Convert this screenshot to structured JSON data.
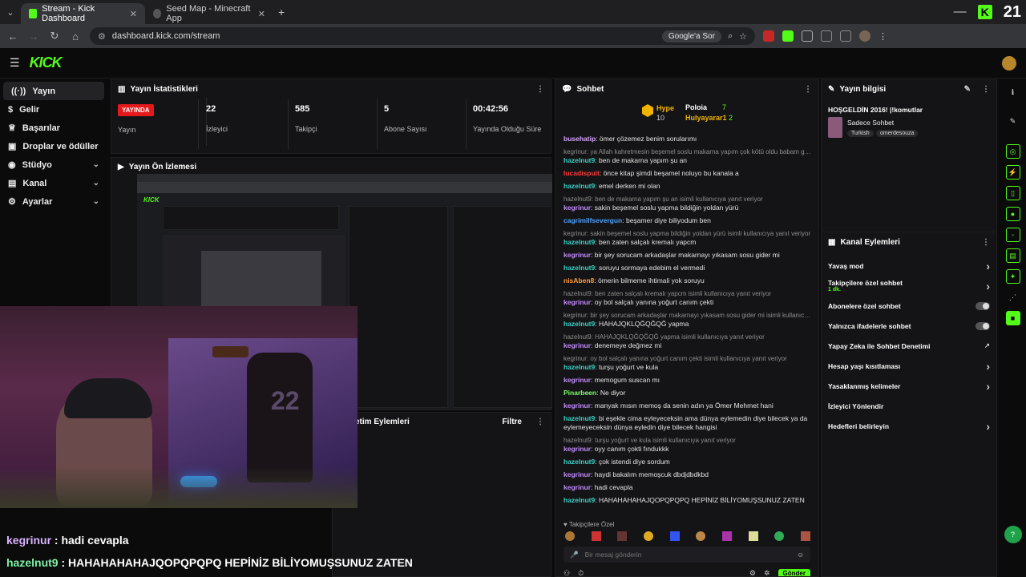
{
  "browser": {
    "tabs": [
      {
        "label": "Stream - Kick Dashboard",
        "active": true
      },
      {
        "label": "Seed Map - Minecraft App",
        "active": false
      }
    ],
    "url": "dashboard.kick.com/stream",
    "google_btn": "Google'a Sor",
    "badge_count": "21"
  },
  "sidebar": {
    "items": [
      {
        "label": "Yayın",
        "icon": "broadcast-icon",
        "active": true,
        "chevron": false
      },
      {
        "label": "Gelir",
        "icon": "dollar-icon",
        "active": false,
        "chevron": false
      },
      {
        "label": "Başarılar",
        "icon": "trophy-icon",
        "active": false,
        "chevron": false
      },
      {
        "label": "Droplar ve ödüller",
        "icon": "gift-icon",
        "active": false,
        "chevron": false
      },
      {
        "label": "Stüdyo",
        "icon": "studio-icon",
        "active": false,
        "chevron": true
      },
      {
        "label": "Kanal",
        "icon": "channel-icon",
        "active": false,
        "chevron": true
      },
      {
        "label": "Ayarlar",
        "icon": "gear-icon",
        "active": false,
        "chevron": true
      }
    ]
  },
  "stats": {
    "title": "Yayın İstatistikleri",
    "live_label": "YAYINDA",
    "live_caption": "Yayın",
    "viewers": {
      "value": "22",
      "label": "İzleyici"
    },
    "followers": {
      "value": "585",
      "label": "Takipçi"
    },
    "subs": {
      "value": "5",
      "label": "Abone Sayısı"
    },
    "duration": {
      "value": "00:42:56",
      "label": "Yayında Olduğu Süre"
    }
  },
  "preview": {
    "title": "Yayın Ön İzlemesi"
  },
  "actions": {
    "title": "etim Eylemleri",
    "filter": "Filtre"
  },
  "chat": {
    "title": "Sohbet",
    "hype_label": "Hype",
    "hype_value": "10",
    "leader1": "Poloia",
    "leader1_count": "7",
    "leader2": "Hulyayarar1",
    "leader2_count": "2",
    "messages": [
      {
        "reply": "",
        "user": "busehatip",
        "color": "#d7a6ff",
        "text": "ömer çözemez benim sorularımı"
      },
      {
        "reply": "kegrinur: ya Allah kahretmesin beşemel soslu makarna yapım çok kötü oldu babam göree agz...",
        "user": "hazelnut9",
        "color": "#3ad1c4",
        "text": "ben de makarna yapım şu an"
      },
      {
        "reply": "",
        "user": "lucadispuit",
        "color": "#ff3b3b",
        "text": "önce kitap şimdi beşamel noluyo bu kanala a"
      },
      {
        "reply": "",
        "user": "hazelnut9",
        "color": "#3ad1c4",
        "text": "emel derken mi olan"
      },
      {
        "reply": "hazelnut9: ben de makarna yapım şu an isimli kullanıcıya yanıt veriyor",
        "user": "kegrinur",
        "color": "#c38cff",
        "text": "sakin beşemel soslu yapma bildiğin yoldan yürü"
      },
      {
        "reply": "",
        "user": "cagrimilfsevergun",
        "color": "#4da3ff",
        "text": "beşamer diye biliyodum ben"
      },
      {
        "reply": "kegrinur: sakin beşemel soslu yapma bildiğin yoldan yürü isimli kullanıcıya yanıt veriyor",
        "user": "hazelnut9",
        "color": "#3ad1c4",
        "text": "ben zaten salçalı kremalı yapcm"
      },
      {
        "reply": "",
        "user": "kegrinur",
        "color": "#c38cff",
        "text": "bir şey sorucam arkadaşlar makarnayı yıkasam sosu gider mi"
      },
      {
        "reply": "",
        "user": "hazelnut9",
        "color": "#3ad1c4",
        "text": "soruyu sormaya edebim el vermedi"
      },
      {
        "reply": "",
        "user": "nisAben8",
        "color": "#ff9a3c",
        "text": "ömerin bilmeme ihtimali yok soruyu"
      },
      {
        "reply": "hazelnut9: ben zaten salçalı kremalı yapcm isimli kullanıcıya yanıt veriyor",
        "user": "kegrinur",
        "color": "#c38cff",
        "text": "oy bol salçalı yanına yoğurt canım çekti"
      },
      {
        "reply": "kegrinur: bir şey sorucam arkadaşlar makarnayı yıkasam sosu gider mi isimli kullanıcıya yanıt ve...",
        "user": "hazelnut9",
        "color": "#3ad1c4",
        "text": "HAHAJQKLQĞQĞQĞ yapma"
      },
      {
        "reply": "hazelnut9: HAHAJQKLQĞQĞQĞ yapma isimli kullanıcıya yanıt veriyor",
        "user": "kegrinur",
        "color": "#c38cff",
        "text": "denemeye değmez mi"
      },
      {
        "reply": "kegrinur: oy bol salçalı yanına yoğurt canım çekti isimli kullanıcıya yanıt veriyor",
        "user": "hazelnut9",
        "color": "#3ad1c4",
        "text": "turşu yoğurt ve kula"
      },
      {
        "reply": "",
        "user": "kegrinur",
        "color": "#c38cff",
        "text": "memogum suscan mı"
      },
      {
        "reply": "",
        "user": "Pinarbeen",
        "color": "#7dff6a",
        "text": "Ne diyor"
      },
      {
        "reply": "",
        "user": "kegrinur",
        "color": "#c38cff",
        "text": "manyak mısın memoş da senin adın ya Ömer Mehmet hani"
      },
      {
        "reply": "",
        "user": "hazelnut9",
        "color": "#3ad1c4",
        "text": "bi eşekle cima eyleyeceksin ama dünya eylemedin diye bilecek ya da eylemeyeceksin dünya eyledin diye bilecek hangisi"
      },
      {
        "reply": "hazelnut9: turşu yoğurt ve kula isimli kullanıcıya yanıt veriyor",
        "user": "kegrinur",
        "color": "#c38cff",
        "text": "oyy canım çokti fındukkk"
      },
      {
        "reply": "",
        "user": "hazelnut9",
        "color": "#3ad1c4",
        "text": "çok istendi diye sordum"
      },
      {
        "reply": "",
        "user": "kegrinur",
        "color": "#c38cff",
        "text": "haydi bakalım memoşcuk dbdjdbdkbd"
      },
      {
        "reply": "",
        "user": "kegrinur",
        "color": "#c38cff",
        "text": "hadi cevapla"
      },
      {
        "reply": "",
        "user": "hazelnut9",
        "color": "#3ad1c4",
        "text": "HAHAHAHAHAJQOPQPQPQ HEPİNİZ BİLİYOMUŞSUNUZ ZATEN"
      }
    ],
    "followers_only": "Takipçilere Özel",
    "input_placeholder": "Bir mesaj gönderin",
    "send": "Gönder"
  },
  "info": {
    "title": "Yayın bilgisi",
    "stream_title": "HOŞGELDİN 2016! |!komutlar",
    "category": "Sadece Sohbet",
    "tags": [
      "Turkish",
      "omerdesouza"
    ]
  },
  "channel_actions": {
    "title": "Kanal Eylemleri",
    "items": [
      {
        "label": "Yavaş mod",
        "sub": "",
        "right": "chevron"
      },
      {
        "label": "Takipçilere özel sohbet",
        "sub": "1 dk.",
        "right": "chevron"
      },
      {
        "label": "Abonelere özel sohbet",
        "sub": "",
        "right": "toggle"
      },
      {
        "label": "Yalnızca ifadelerle sohbet",
        "sub": "",
        "right": "toggle"
      },
      {
        "label": "Yapay Zeka ile Sohbet Denetimi",
        "sub": "",
        "right": "external"
      },
      {
        "label": "Hesap yaşı kısıtlaması",
        "sub": "",
        "right": "chevron"
      },
      {
        "label": "Yasaklanmış kelimeler",
        "sub": "",
        "right": "chevron"
      },
      {
        "label": "İzleyici Yönlendir",
        "sub": "",
        "right": ""
      },
      {
        "label": "Hedefleri belirleyin",
        "sub": "",
        "right": "chevron"
      }
    ]
  },
  "captions": [
    {
      "user": "kegrinur",
      "color": "#d9b3ff",
      "text": "hadi cevapla"
    },
    {
      "user": "hazelnut9",
      "color": "#7ef2a6",
      "text": "HAHAHAHAHAJQOPQPQPQ HEPİNİZ BİLİYOMUŞSUNUZ ZATEN"
    }
  ],
  "colors": {
    "brand": "#53fc18",
    "live": "#e5191c"
  }
}
